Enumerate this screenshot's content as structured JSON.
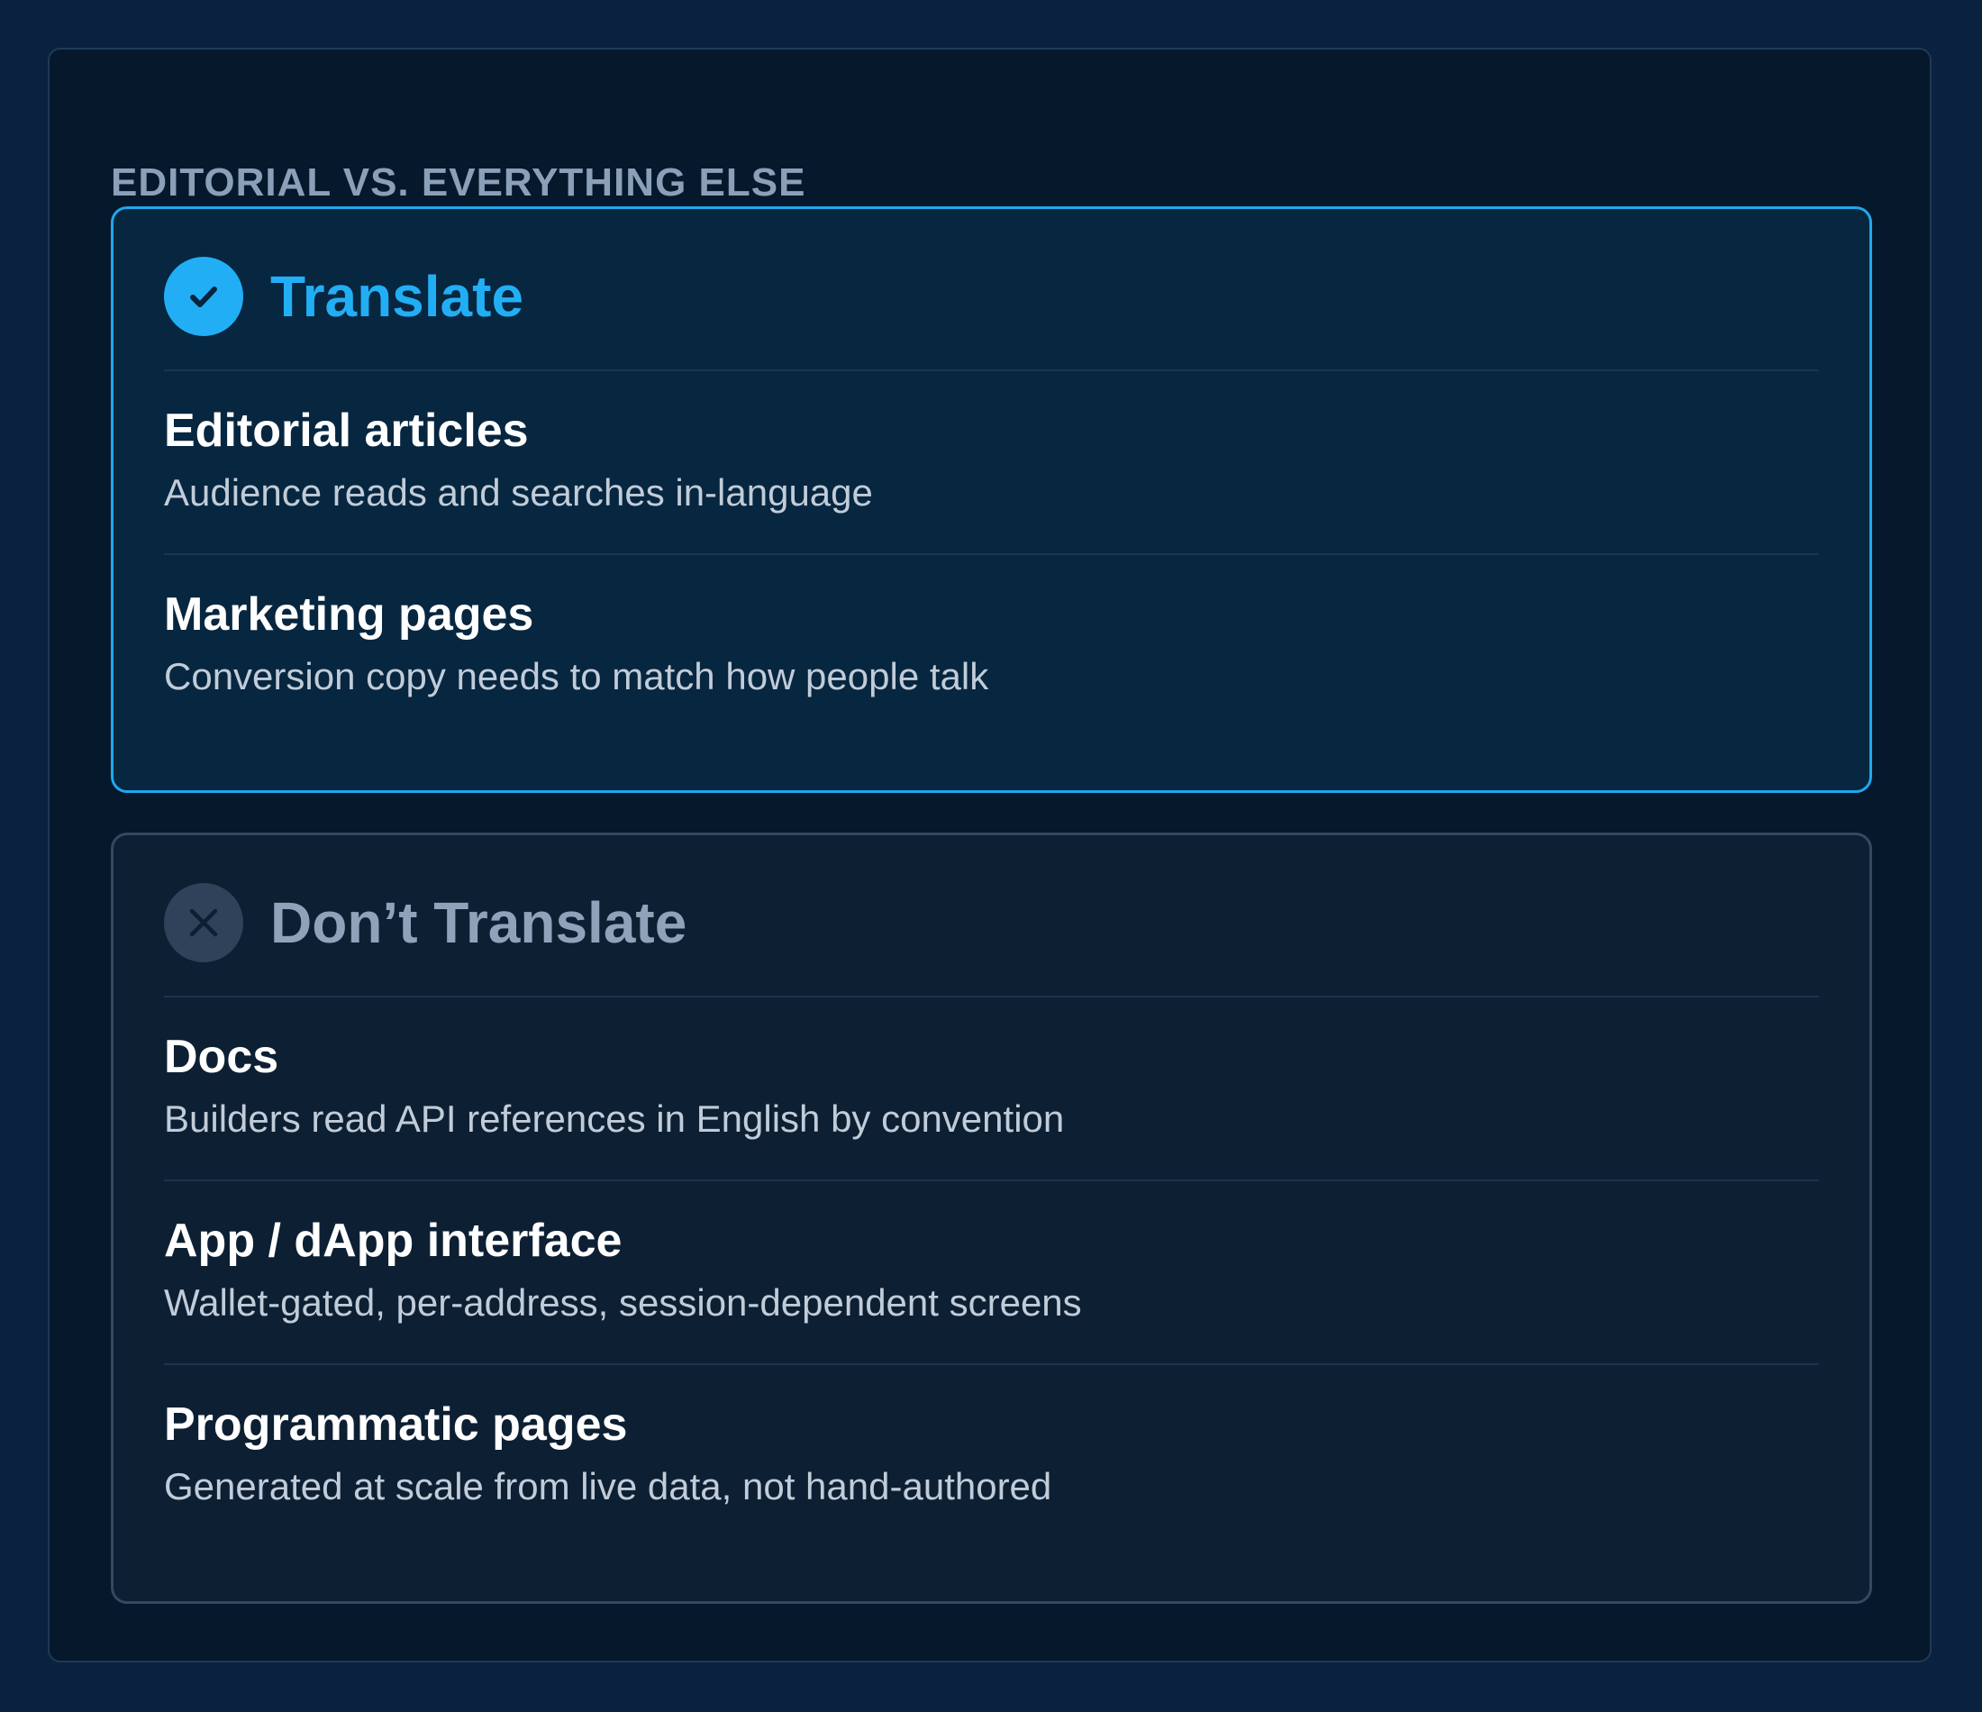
{
  "section": {
    "heading": "EDITORIAL VS. EVERYTHING ELSE"
  },
  "translate": {
    "icon": "check-circle-icon",
    "title": "Translate",
    "accent_color": "#22aef5",
    "items": [
      {
        "title": "Editorial articles",
        "description": "Audience reads and searches in-language"
      },
      {
        "title": "Marketing pages",
        "description": "Conversion copy needs to match how people talk"
      }
    ]
  },
  "dont_translate": {
    "icon": "x-circle-icon",
    "title": "Don’t Translate",
    "accent_color": "#8ea3ba",
    "items": [
      {
        "title": "Docs",
        "description": "Builders read API references in English by convention"
      },
      {
        "title": "App / dApp interface",
        "description": "Wallet-gated, per-address, session-dependent screens"
      },
      {
        "title": "Programmatic pages",
        "description": "Generated at scale from live data, not hand-authored"
      }
    ]
  }
}
